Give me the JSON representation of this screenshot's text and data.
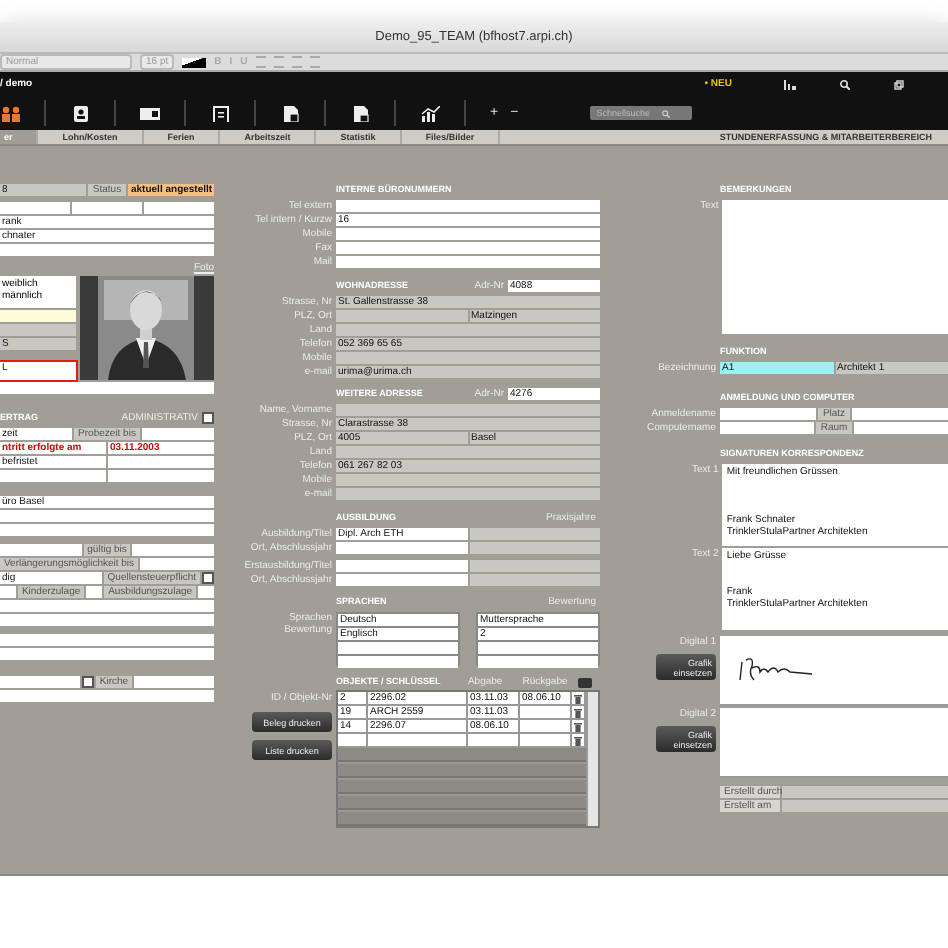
{
  "window": {
    "title": "Demo_95_TEAM (bfhost7.arpi.ch)"
  },
  "format_bar": {
    "style": "Normal",
    "size": "16 pt",
    "text_styles": [
      "B",
      "I",
      "U"
    ]
  },
  "header": {
    "path": "/ demo",
    "new_label": "• NEU",
    "plus": "+",
    "minus": "−",
    "search": {
      "placeholder": "Schnellsuche"
    }
  },
  "tabs": [
    {
      "label": "er",
      "selected": true
    },
    {
      "label": "Lohn/Kosten",
      "selected": false
    },
    {
      "label": "Ferien",
      "selected": false
    },
    {
      "label": "Arbeitszeit",
      "selected": false
    },
    {
      "label": "Statistik",
      "selected": false
    },
    {
      "label": "Files/Bilder",
      "selected": false
    }
  ],
  "section_title": "STUNDENERFASSUNG & MITARBEITERBEREICH",
  "left": {
    "groups": [
      [
        {
          "kind": "row",
          "cells": [
            {
              "kind": "grey",
              "text": "8"
            },
            {
              "kind": "label",
              "text": "Status"
            },
            {
              "kind": "orange",
              "text": "aktuell angestellt"
            }
          ]
        }
      ],
      [
        {
          "kind": "row",
          "cells": [
            {
              "kind": "white"
            },
            {
              "kind": "white"
            },
            {
              "kind": "white"
            }
          ]
        },
        {
          "kind": "row",
          "cells": [
            {
              "kind": "white",
              "text": "rank"
            }
          ]
        },
        {
          "kind": "row",
          "cells": [
            {
              "kind": "white",
              "text": "chnater"
            }
          ]
        },
        {
          "kind": "row",
          "cells": [
            {
              "kind": "white"
            }
          ]
        }
      ],
      [
        {
          "kind": "link",
          "text": "Foto"
        }
      ],
      [
        {
          "kind": "photo-block",
          "options": [
            "weiblich",
            "männlich"
          ],
          "cells": [
            {
              "kind": "yellow"
            },
            {
              "kind": "grey"
            },
            {
              "kind": "grey",
              "text": "S"
            },
            {
              "kind": "outlined",
              "text": "L"
            }
          ]
        },
        {
          "kind": "row",
          "cells": [
            {
              "kind": "white"
            }
          ]
        }
      ],
      [
        {
          "kind": "header",
          "title": "ERTRAG",
          "side_label": "ADMINISTRATIV",
          "checkbox": {
            "checked": false
          }
        },
        {
          "kind": "row",
          "cells": [
            {
              "kind": "white",
              "text": "zeit"
            },
            {
              "kind": "label",
              "text": "Probezeit bis"
            },
            {
              "kind": "white"
            }
          ]
        },
        {
          "kind": "row",
          "cells": [
            {
              "kind": "red",
              "text": "ntritt erfolgte am"
            },
            {
              "kind": "red",
              "text": "03.11.2003"
            }
          ]
        },
        {
          "kind": "row",
          "cells": [
            {
              "kind": "white",
              "text": "befristet"
            },
            {
              "kind": "white"
            }
          ]
        },
        {
          "kind": "row",
          "cells": [
            {
              "kind": "white"
            },
            {
              "kind": "white"
            }
          ]
        }
      ],
      [
        {
          "kind": "row",
          "cells": [
            {
              "kind": "white",
              "text": "üro Basel"
            }
          ]
        },
        {
          "kind": "row",
          "cells": [
            {
              "kind": "white"
            }
          ]
        },
        {
          "kind": "row",
          "cells": [
            {
              "kind": "white"
            }
          ]
        }
      ],
      [
        {
          "kind": "row",
          "cells": [
            {
              "kind": "white"
            },
            {
              "kind": "label",
              "text": "gültig bis"
            },
            {
              "kind": "white"
            }
          ]
        },
        {
          "kind": "row",
          "cells": [
            {
              "kind": "label",
              "text": "Verlängerungsmöglichkeit bis"
            },
            {
              "kind": "white"
            }
          ]
        },
        {
          "kind": "row",
          "cells": [
            {
              "kind": "white",
              "text": "dig"
            },
            {
              "kind": "label",
              "text": "Quellensteuerpflicht"
            },
            {
              "kind": "checkbox",
              "checked": false
            }
          ]
        },
        {
          "kind": "row",
          "cells": [
            {
              "kind": "white"
            },
            {
              "kind": "label",
              "text": "Kinderzulage"
            },
            {
              "kind": "white"
            },
            {
              "kind": "label",
              "text": "Ausbildungszulage"
            },
            {
              "kind": "white"
            }
          ]
        },
        {
          "kind": "row",
          "cells": [
            {
              "kind": "white"
            }
          ]
        },
        {
          "kind": "row",
          "cells": [
            {
              "kind": "white"
            }
          ]
        }
      ],
      [
        {
          "kind": "row",
          "cells": [
            {
              "kind": "white"
            }
          ]
        },
        {
          "kind": "row",
          "cells": [
            {
              "kind": "white"
            }
          ]
        }
      ],
      [
        {
          "kind": "row",
          "cells": [
            {
              "kind": "white"
            },
            {
              "kind": "checkbox",
              "checked": false
            },
            {
              "kind": "label",
              "text": "Kirche"
            },
            {
              "kind": "white"
            }
          ]
        },
        {
          "kind": "row",
          "cells": [
            {
              "kind": "white"
            }
          ]
        }
      ]
    ]
  },
  "middle": {
    "groups": [
      [
        {
          "kind": "header",
          "title": "INTERNE BÜRONUMMERN"
        },
        {
          "kind": "row",
          "label": "Tel extern",
          "cells": [
            {
              "kind": "white"
            }
          ]
        },
        {
          "kind": "row",
          "label": "Tel intern / Kurzw",
          "cells": [
            {
              "kind": "white",
              "text": "16"
            }
          ]
        },
        {
          "kind": "row",
          "label": "Mobile",
          "cells": [
            {
              "kind": "white"
            }
          ]
        },
        {
          "kind": "row",
          "label": "Fax",
          "cells": [
            {
              "kind": "white"
            }
          ]
        },
        {
          "kind": "row",
          "label": "Mail",
          "cells": [
            {
              "kind": "white"
            }
          ]
        }
      ],
      [
        {
          "kind": "header",
          "title": "WOHNADRESSE",
          "side_label": "Adr-Nr",
          "side_value": "4088"
        },
        {
          "kind": "row",
          "label": "Strasse, Nr",
          "cells": [
            {
              "kind": "grey",
              "text": "St. Gallenstrasse 38"
            }
          ]
        },
        {
          "kind": "row",
          "label": "PLZ, Ort",
          "cells": [
            {
              "kind": "grey"
            },
            {
              "kind": "grey",
              "text": "Matzingen"
            }
          ]
        },
        {
          "kind": "row",
          "label": "Land",
          "cells": [
            {
              "kind": "grey"
            }
          ]
        },
        {
          "kind": "row",
          "label": "Telefon",
          "cells": [
            {
              "kind": "grey",
              "text": "052 369 65 65"
            }
          ]
        },
        {
          "kind": "row",
          "label": "Mobile",
          "cells": [
            {
              "kind": "grey"
            }
          ]
        },
        {
          "kind": "row",
          "label": "e-mail",
          "cells": [
            {
              "kind": "grey",
              "text": "urima@urima.ch"
            }
          ]
        }
      ],
      [
        {
          "kind": "header",
          "title": "WEITERE ADRESSE",
          "side_label": "Adr-Nr",
          "side_value": "4276"
        },
        {
          "kind": "row",
          "label": "Name, Vorname",
          "cells": [
            {
              "kind": "grey"
            }
          ]
        },
        {
          "kind": "row",
          "label": "Strasse, Nr",
          "cells": [
            {
              "kind": "grey",
              "text": "Clarastrasse 38"
            }
          ]
        },
        {
          "kind": "row",
          "label": "PLZ, Ort",
          "cells": [
            {
              "kind": "grey",
              "text": "4005"
            },
            {
              "kind": "grey",
              "text": "Basel"
            }
          ]
        },
        {
          "kind": "row",
          "label": "Land",
          "cells": [
            {
              "kind": "grey"
            }
          ]
        },
        {
          "kind": "row",
          "label": "Telefon",
          "cells": [
            {
              "kind": "grey",
              "text": "061 267 82 03"
            }
          ]
        },
        {
          "kind": "row",
          "label": "Mobile",
          "cells": [
            {
              "kind": "grey"
            }
          ]
        },
        {
          "kind": "row",
          "label": "e-mail",
          "cells": [
            {
              "kind": "grey"
            }
          ]
        }
      ],
      [
        {
          "kind": "header",
          "title": "AUSBILDUNG",
          "side_label": "Praxisjahre"
        },
        {
          "kind": "row",
          "label": "Ausbildung/Titel",
          "cells": [
            {
              "kind": "white",
              "text": "Dipl. Arch ETH"
            },
            {
              "kind": "grey"
            }
          ]
        },
        {
          "kind": "row",
          "label": "Ort, Abschlussjahr",
          "cells": [
            {
              "kind": "white"
            },
            {
              "kind": "grey"
            }
          ]
        }
      ],
      [
        {
          "kind": "row",
          "label": "Erstausbildung/Titel",
          "cells": [
            {
              "kind": "white"
            },
            {
              "kind": "grey"
            }
          ]
        },
        {
          "kind": "row",
          "label": "Ort, Abschlussjahr",
          "cells": [
            {
              "kind": "white"
            },
            {
              "kind": "grey"
            }
          ]
        }
      ],
      [
        {
          "kind": "header",
          "title": "SPRACHEN",
          "side_label": "Bewertung"
        },
        {
          "kind": "languages",
          "labels": [
            "Sprachen",
            "Bewertung"
          ],
          "rows": [
            {
              "language": "Deutsch",
              "rating": "Muttersprache"
            },
            {
              "language": "Englisch",
              "rating": "2"
            },
            {},
            {}
          ]
        }
      ],
      [
        {
          "kind": "objects",
          "title": "OBJEKTE / SCHLÜSSEL",
          "columns": [
            "Abgabe",
            "Rückgabe"
          ],
          "label": "ID / Objekt-Nr",
          "buttons": [
            "Beleg drucken",
            "Liste drucken"
          ],
          "rows": [
            {
              "id": "2",
              "object": "2296.02",
              "given": "03.11.03",
              "returned": "08.06.10"
            },
            {
              "id": "19",
              "object": "ARCH 2559",
              "given": "03.11.03"
            },
            {
              "id": "14",
              "object": "2296.07",
              "given": "08.06.10"
            },
            {}
          ]
        }
      ]
    ]
  },
  "right": {
    "groups": [
      [
        {
          "kind": "header",
          "title": "BEMERKUNGEN"
        },
        {
          "kind": "textarea",
          "label": "Text"
        }
      ],
      [
        {
          "kind": "header",
          "title": "FUNKTION"
        },
        {
          "kind": "row",
          "label": "Bezeichnung",
          "cells": [
            {
              "kind": "cyan",
              "text": "A1"
            },
            {
              "kind": "grey",
              "text": "Architekt 1"
            }
          ]
        }
      ],
      [
        {
          "kind": "header",
          "title": "ANMELDUNG UND COMPUTER"
        },
        {
          "kind": "row",
          "label": "Anmeldename",
          "cells": [
            {
              "kind": "white"
            },
            {
              "kind": "label",
              "text": "Platz"
            },
            {
              "kind": "white"
            }
          ]
        },
        {
          "kind": "row",
          "label": "Computername",
          "cells": [
            {
              "kind": "white"
            },
            {
              "kind": "label",
              "text": "Raum"
            },
            {
              "kind": "white"
            }
          ]
        }
      ],
      [
        {
          "kind": "header",
          "title": "SIGNATUREN KORRESPONDENZ"
        },
        {
          "kind": "textarea",
          "label": "Text 1",
          "text": "Mit freundlichen Grüssen\n\n\n\nFrank Schnater\nTrinklerStulaPartner Architekten"
        },
        {
          "kind": "textarea",
          "label": "Text 2",
          "text": "Liebe Grüsse\n\n\nFrank\nTrinklerStulaPartner Architekten"
        }
      ],
      [
        {
          "kind": "digital",
          "label": "Digital 1",
          "button": "Grafik einsetzen",
          "signature": true
        },
        {
          "kind": "digital",
          "label": "Digital 2",
          "button": "Grafik einsetzen",
          "signature": false
        }
      ],
      [
        {
          "kind": "row",
          "cells": [
            {
              "kind": "label",
              "text": "Erstellt durch"
            },
            {
              "kind": "grey"
            }
          ]
        },
        {
          "kind": "row",
          "cells": [
            {
              "kind": "label",
              "text": "Erstellt am"
            },
            {
              "kind": "grey"
            }
          ]
        }
      ]
    ]
  }
}
